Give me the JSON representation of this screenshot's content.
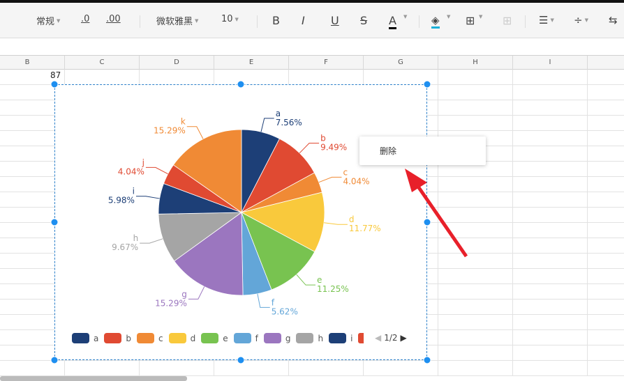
{
  "toolbar": {
    "number_format": "常规",
    "decrease_decimal": ".0",
    "increase_decimal": ".00",
    "font": "微软雅黑",
    "font_size": "10",
    "bold": "B",
    "italic": "I",
    "underline": "U",
    "strike": "S",
    "font_color": "A"
  },
  "columns": [
    "B",
    "C",
    "D",
    "E",
    "F",
    "G",
    "H",
    "I"
  ],
  "cell_value": "87",
  "context_menu": {
    "delete": "删除"
  },
  "legend_pager": "1/2",
  "chart_data": {
    "type": "pie",
    "categories": [
      "a",
      "b",
      "c",
      "d",
      "e",
      "f",
      "g",
      "h",
      "i",
      "j",
      "k"
    ],
    "values": [
      7.56,
      9.49,
      4.04,
      11.77,
      11.25,
      5.62,
      15.29,
      9.67,
      5.98,
      4.04,
      15.29
    ],
    "labels": [
      "7.56%",
      "9.49%",
      "4.04%",
      "11.77%",
      "11.25%",
      "5.62%",
      "15.29%",
      "9.67%",
      "5.98%",
      "4.04%",
      "15.29%"
    ],
    "colors": [
      "#1d3f77",
      "#e04a32",
      "#f08a35",
      "#f9c93c",
      "#78c350",
      "#63a6d8",
      "#9b76bf",
      "#a5a5a5",
      "#1d3f77",
      "#e04a32",
      "#f08a35"
    ],
    "legend": "bottom",
    "legend_visible_items": [
      "a",
      "b",
      "c",
      "d",
      "e",
      "f",
      "g",
      "h",
      "i"
    ]
  }
}
